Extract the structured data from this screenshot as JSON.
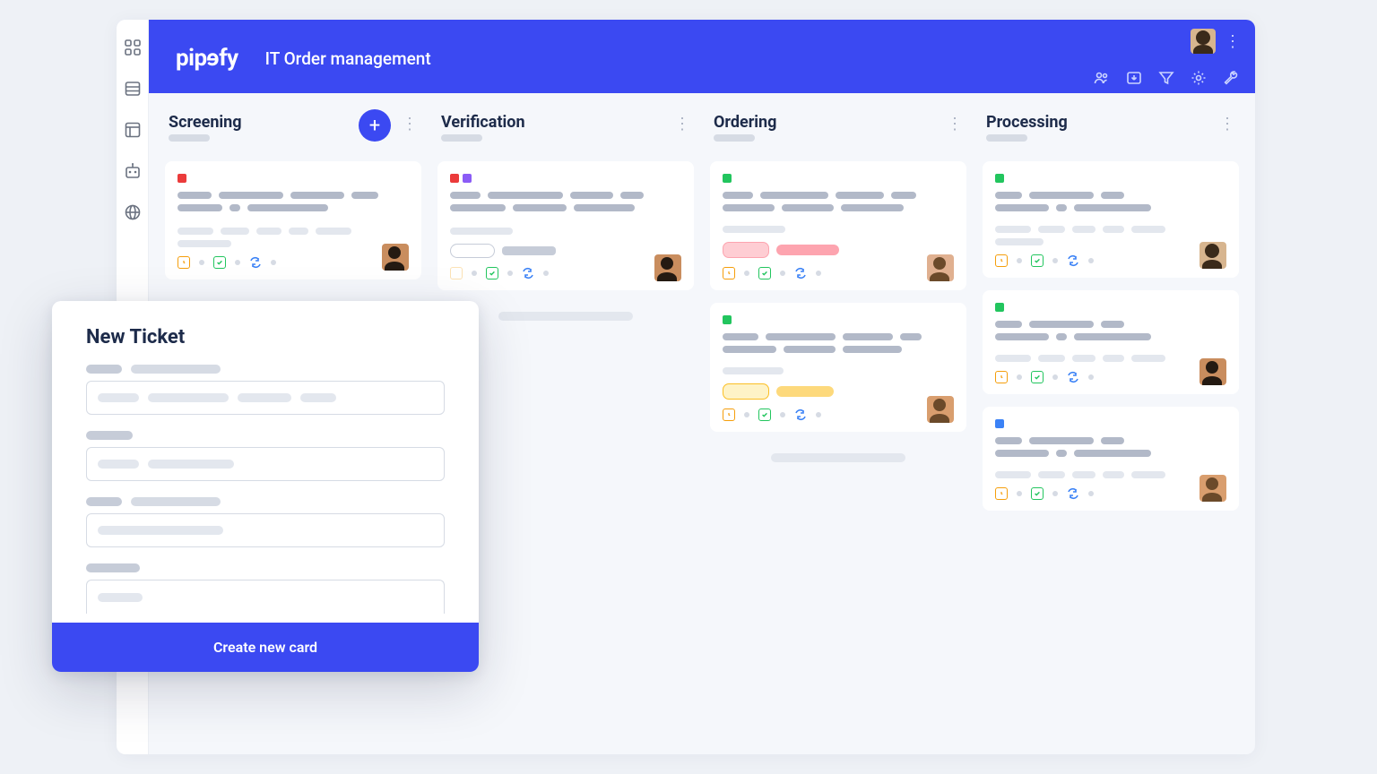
{
  "brand": "pipefy",
  "page_title": "IT Order management",
  "columns": [
    {
      "title": "Screening",
      "has_add": true
    },
    {
      "title": "Verification",
      "has_add": false
    },
    {
      "title": "Ordering",
      "has_add": false
    },
    {
      "title": "Processing",
      "has_add": false
    }
  ],
  "modal": {
    "title": "New Ticket",
    "submit_label": "Create new card"
  },
  "colors": {
    "primary": "#3b49f2",
    "red": "#eb3b3b",
    "purple": "#8b5cf6",
    "green": "#22c55e",
    "blue": "#3b82f6",
    "orange": "#f59e0b"
  }
}
